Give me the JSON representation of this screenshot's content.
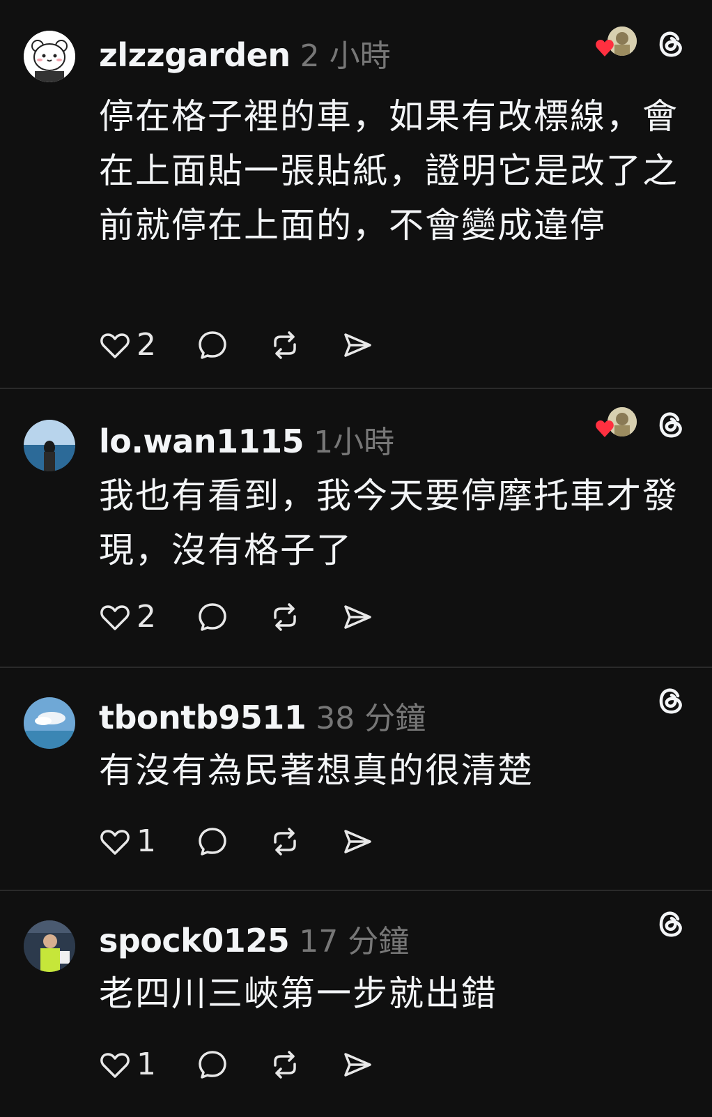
{
  "posts": [
    {
      "username": "zlzzgarden",
      "time": "2 小時",
      "text": "停在格子裡的車，如果有改標線，會在上面貼一張貼紙，證明它是改了之前就停在上面的，不會變成違停",
      "likes": "2",
      "liked_by_author": true
    },
    {
      "username": "lo.wan1115",
      "time": "1小時",
      "text": "我也有看到，我今天要停摩托車才發現，沒有格子了",
      "likes": "2",
      "liked_by_author": true
    },
    {
      "username": "tbontb9511",
      "time": "38 分鐘",
      "text": "有沒有為民著想真的很清楚",
      "likes": "1",
      "liked_by_author": false
    },
    {
      "username": "spock0125",
      "time": "17 分鐘",
      "text": "老四川三峽第一步就出錯",
      "likes": "1",
      "liked_by_author": false
    }
  ],
  "icons": {
    "like": "heart-outline-icon",
    "comment": "speech-bubble-icon",
    "repost": "repost-arrows-icon",
    "share": "paper-plane-icon",
    "brand": "threads-logo-icon",
    "liked_marker": "red-heart-icon"
  },
  "colors": {
    "background": "#101010",
    "text": "#f3f5f7",
    "secondary": "#777777",
    "divider": "#2a2a2a",
    "heart": "#ff3040"
  }
}
